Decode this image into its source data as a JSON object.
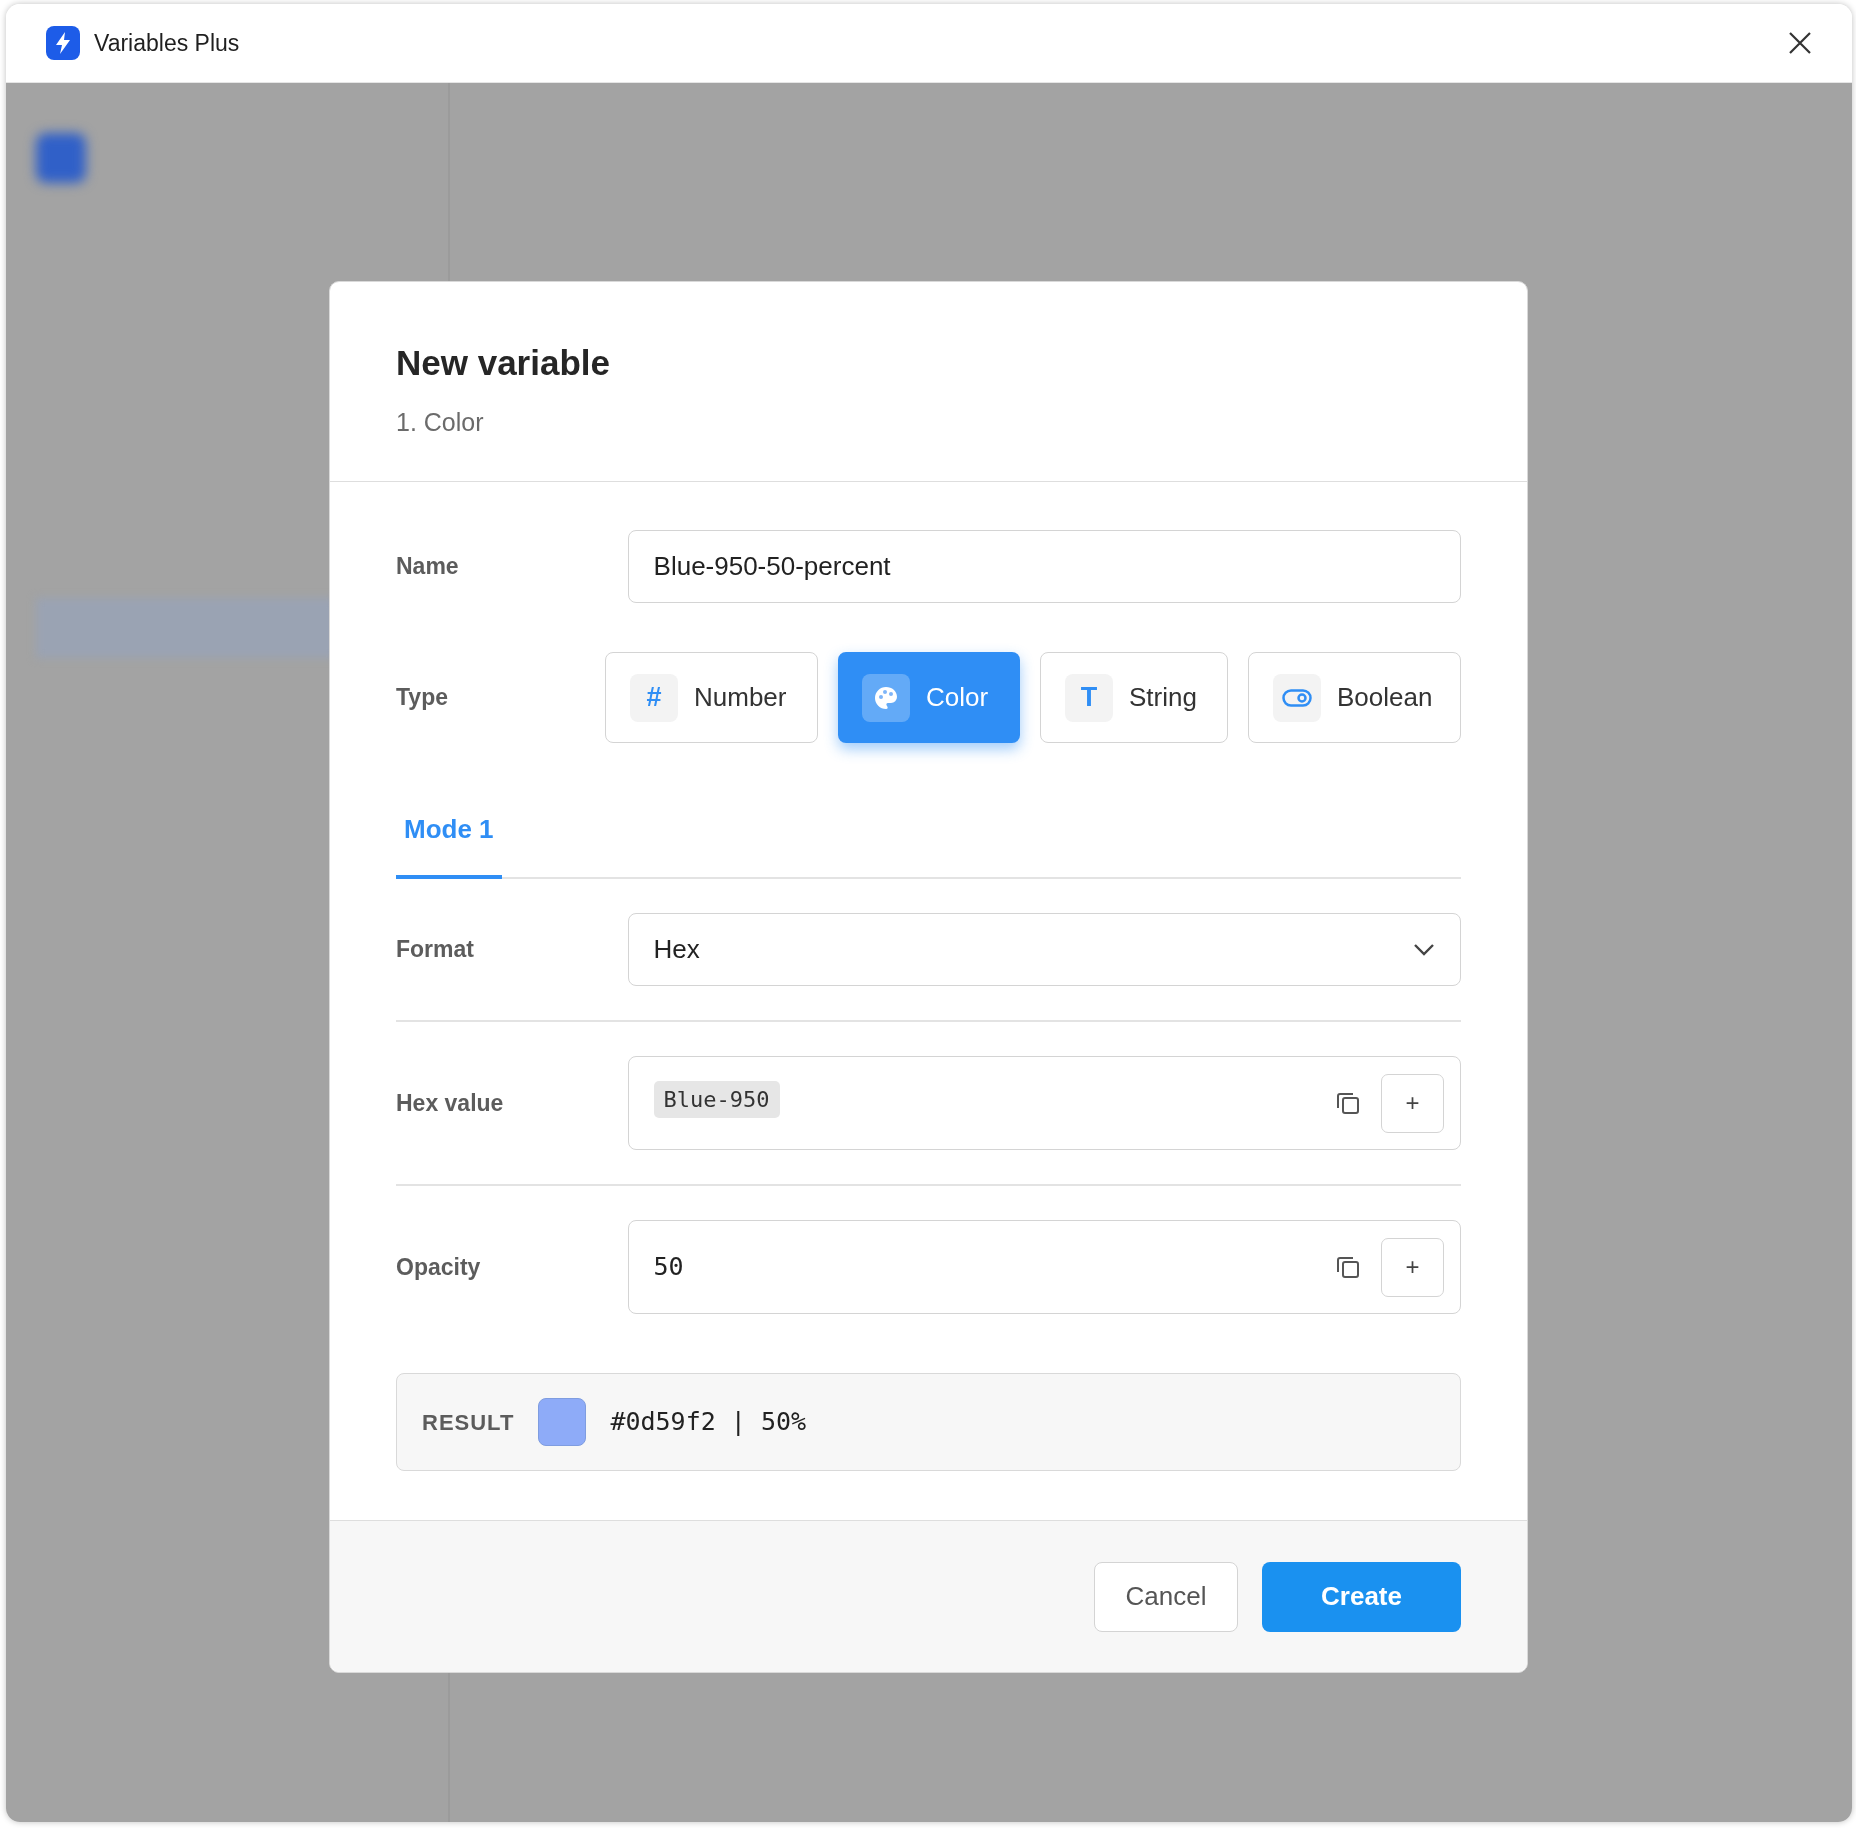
{
  "window": {
    "title": "Variables Plus"
  },
  "dialog": {
    "title": "New variable",
    "subtitle": "1. Color",
    "name_field": {
      "label": "Name",
      "value": "Blue-950-50-percent"
    },
    "type": {
      "label": "Type",
      "options": [
        {
          "kind": "glyph",
          "glyph": "#",
          "label": "Number",
          "selected": false
        },
        {
          "kind": "palette",
          "label": "Color",
          "selected": true
        },
        {
          "kind": "glyph",
          "glyph": "T",
          "label": "String",
          "selected": false
        },
        {
          "kind": "toggle",
          "label": "Boolean",
          "selected": false
        }
      ]
    },
    "tabs": [
      {
        "label": "Mode 1",
        "selected": true
      }
    ],
    "mode_fields": [
      {
        "kind": "select",
        "label": "Format",
        "value": "Hex"
      },
      {
        "kind": "token",
        "label": "Hex value",
        "token": "Blue-950",
        "action": "+"
      },
      {
        "kind": "value",
        "label": "Opacity",
        "value": "50",
        "action": "+"
      }
    ],
    "result": {
      "label": "RESULT",
      "color": "#8eabf8",
      "text": "#0d59f2 | 50%"
    },
    "buttons": [
      {
        "kind": "secondary",
        "label": "Cancel"
      },
      {
        "kind": "primary",
        "label": "Create"
      }
    ]
  }
}
